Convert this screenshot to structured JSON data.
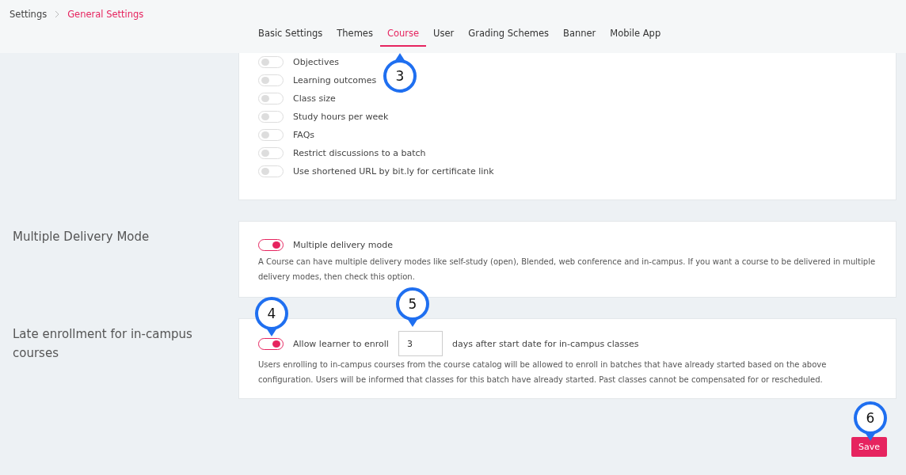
{
  "breadcrumb": [
    {
      "label": "Settings",
      "selected": false
    },
    {
      "label": "General Settings",
      "selected": true
    }
  ],
  "tabs": [
    {
      "label": "Basic Settings",
      "selected": false
    },
    {
      "label": "Themes",
      "selected": false
    },
    {
      "label": "Course",
      "selected": true
    },
    {
      "label": "User",
      "selected": false
    },
    {
      "label": "Grading Schemes",
      "selected": false
    },
    {
      "label": "Banner",
      "selected": false
    },
    {
      "label": "Mobile App",
      "selected": false
    }
  ],
  "course_options": [
    {
      "label": "Objectives",
      "on": false
    },
    {
      "label": "Learning outcomes",
      "on": false
    },
    {
      "label": "Class size",
      "on": false
    },
    {
      "label": "Study hours per week",
      "on": false
    },
    {
      "label": "FAQs",
      "on": false
    },
    {
      "label": "Restrict discussions to a batch",
      "on": false
    },
    {
      "label": "Use shortened URL by bit.ly for certificate link",
      "on": false
    }
  ],
  "sections": [
    {
      "title": "Multiple Delivery Mode",
      "toggle": {
        "label": "Multiple delivery mode",
        "on": true
      },
      "description": "A Course can have multiple delivery modes like self-study (open), Blended, web conference and in-campus. If you want a course to be delivered in multiple delivery modes, then check this option."
    },
    {
      "title": "Late enrollment for in-campus courses",
      "toggle": {
        "label": "Allow learner to enroll",
        "on": true
      },
      "days_value": "3",
      "suffix": "days after start date for in-campus classes",
      "description": "Users enrolling to in-campus courses from the course catalog will be allowed to enroll in batches that have already started based on the above configuration. Users will be informed that classes for this batch have already started. Past classes cannot be compensated for or rescheduled."
    }
  ],
  "save_button": "Save",
  "callouts": [
    {
      "number": "3",
      "kind": "up"
    },
    {
      "number": "4",
      "kind": "down"
    },
    {
      "number": "5",
      "kind": "down"
    },
    {
      "number": "6",
      "kind": "down"
    }
  ]
}
